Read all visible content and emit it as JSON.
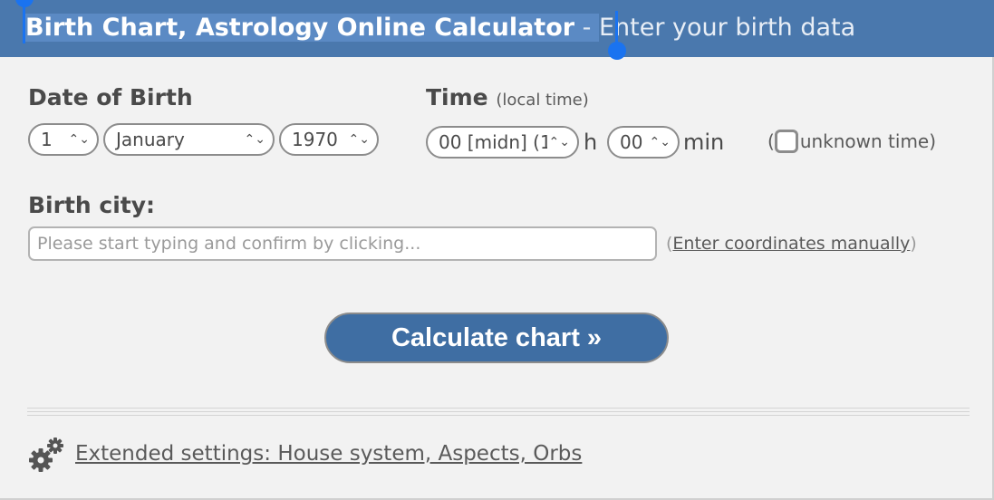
{
  "header": {
    "title_bold": "Birth Chart, Astrology Online Calculator",
    "title_dash": " - ",
    "title_sub": "Enter your birth data"
  },
  "date": {
    "label": "Date of Birth",
    "day": "1",
    "month": "January",
    "year": "1970"
  },
  "time": {
    "label": "Time",
    "note": "(local time)",
    "hour": "00 [midn] (1",
    "hour_unit": "h",
    "minute": "00",
    "minute_unit": "min",
    "unknown_open": "(",
    "unknown_label": "unknown time",
    "unknown_close": ")"
  },
  "city": {
    "label": "Birth city:",
    "placeholder": "Please start typing and confirm by clicking...",
    "coords_open": "(",
    "coords_link": "Enter coordinates manually",
    "coords_close": ")"
  },
  "calculate_label": "Calculate chart »",
  "settings_link": "Extended settings: House system, Aspects, Orbs",
  "icons": {
    "chevron": "chevron-up-down-icon",
    "gear": "gears-icon"
  },
  "colors": {
    "header_bg": "#4a78ad",
    "button_bg": "#3f6ea3",
    "selection_caret": "#1a73f0"
  }
}
